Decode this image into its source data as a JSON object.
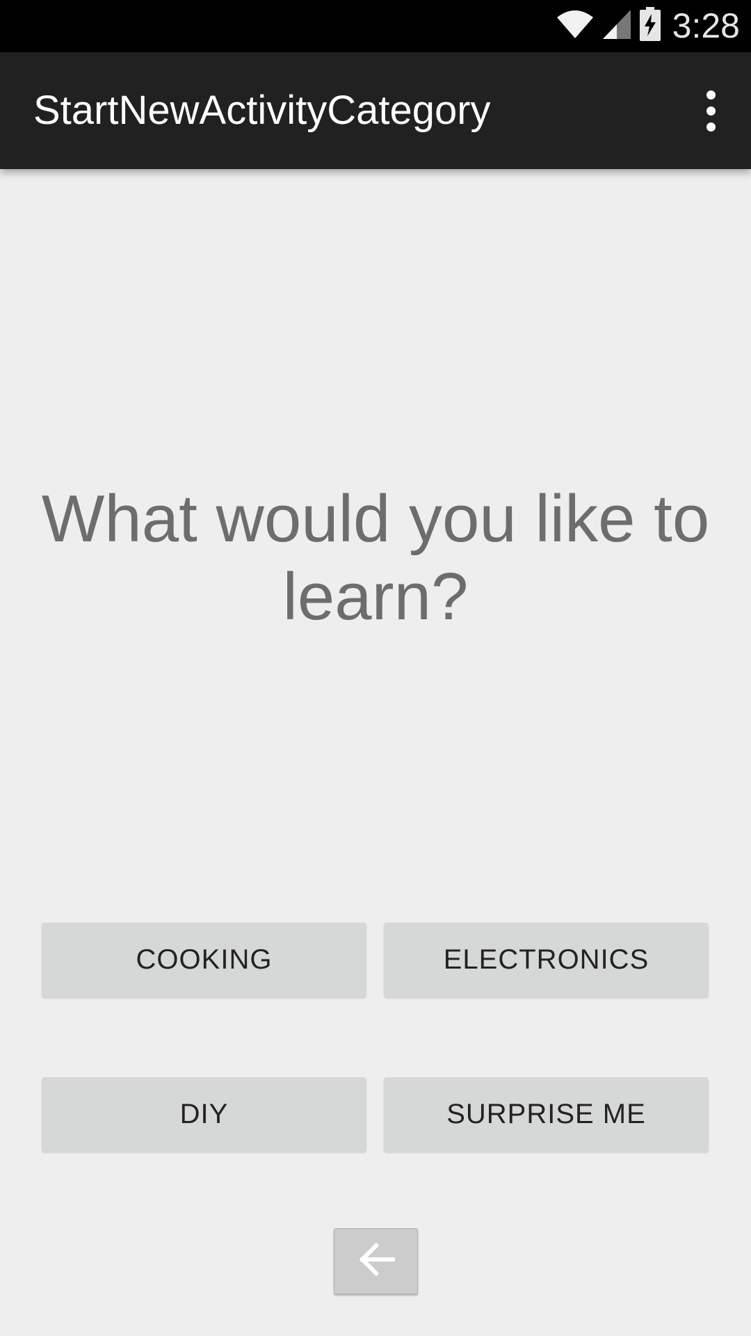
{
  "status_bar": {
    "time": "3:28",
    "icons": [
      "wifi-icon",
      "cell-signal-icon",
      "battery-charging-icon"
    ]
  },
  "app_bar": {
    "title": "StartNewActivityCategory",
    "menu_icon": "overflow-menu-icon"
  },
  "main": {
    "question": "What would you like to learn?",
    "categories": [
      {
        "label": "COOKING"
      },
      {
        "label": "ELECTRONICS"
      },
      {
        "label": "DIY"
      },
      {
        "label": "SURPRISE ME"
      }
    ],
    "back_icon": "arrow-left-icon"
  },
  "colors": {
    "status_bar": "#000000",
    "app_bar": "#212121",
    "background": "#eeeeee",
    "button": "#d6d7d7",
    "question_text": "#6d6d6d"
  }
}
